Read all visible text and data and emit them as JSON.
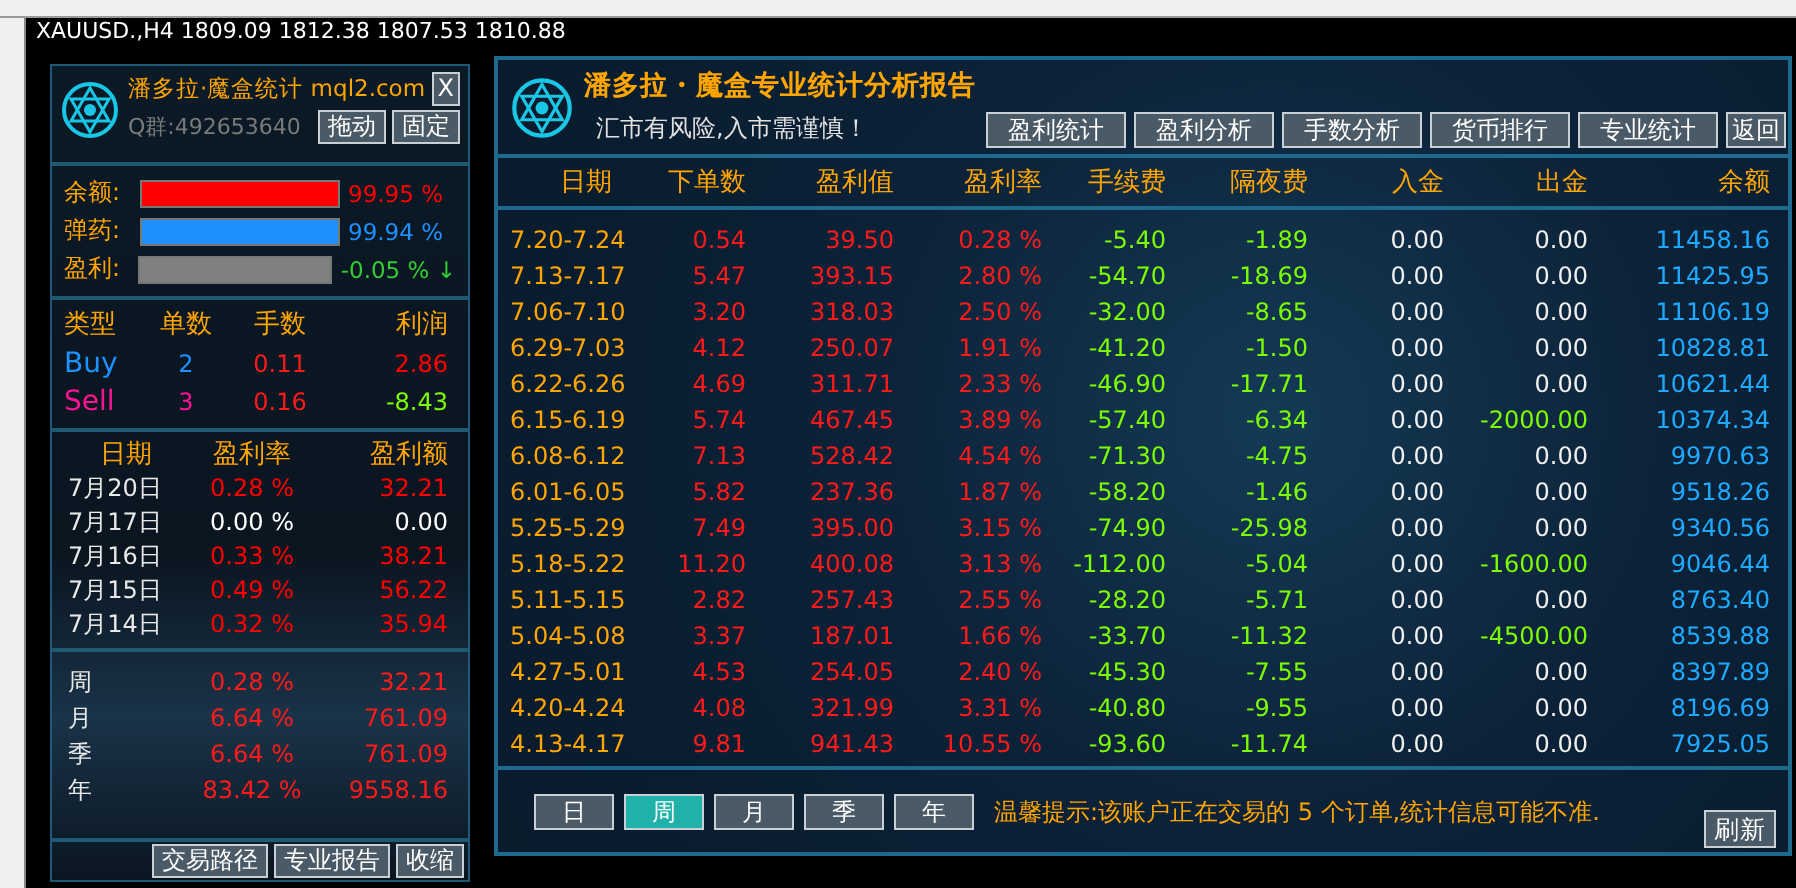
{
  "chart_header": "XAUUSD.,H4  1809.09 1812.38 1807.53 1810.88",
  "mini_panel": {
    "title": "潘多拉·魔盒统计 mql2.com",
    "close": "X",
    "qq": "Q群:492653640",
    "buttons": [
      "拖动",
      "固定"
    ],
    "gauges": [
      {
        "label": "余额:",
        "level": 0.9995,
        "reading": "99.95 %",
        "color": "#ff0000"
      },
      {
        "label": "弹药:",
        "level": 0.9994,
        "reading": "99.94 %",
        "color": "#1e90ff"
      },
      {
        "label": "盈利:",
        "level": 1,
        "reading": "-0.05 % ↓",
        "color": "#808080"
      }
    ],
    "trade_columns": [
      "类型",
      "单数",
      "手数",
      "利润"
    ],
    "trades": [
      {
        "type": "Buy",
        "color": "#1e90ff",
        "orders": "2",
        "lots": "0.11",
        "profit": {
          "text": "2.86",
          "color": "#ff0000"
        }
      },
      {
        "type": "Sell",
        "color": "#ff1493",
        "orders": "3",
        "lots": "0.16",
        "profit": {
          "text": "-8.43",
          "color": "#7cfc00"
        }
      }
    ],
    "day_columns": [
      "日期",
      "盈利率",
      "盈利额"
    ],
    "days": [
      {
        "date": "7月20日",
        "rate": "0.28 %",
        "amount": "32.21",
        "color": "#ff0000"
      },
      {
        "date": "7月17日",
        "rate": "0.00 %",
        "amount": "0.00",
        "color": "#ffffff"
      },
      {
        "date": "7月16日",
        "rate": "0.33 %",
        "amount": "38.21",
        "color": "#ff0000"
      },
      {
        "date": "7月15日",
        "rate": "0.49 %",
        "amount": "56.22",
        "color": "#ff0000"
      },
      {
        "date": "7月14日",
        "rate": "0.32 %",
        "amount": "35.94",
        "color": "#ff0000"
      }
    ],
    "periods": [
      {
        "label": "周",
        "rate": "0.28 %",
        "amount": "32.21"
      },
      {
        "label": "月",
        "rate": "6.64 %",
        "amount": "761.09"
      },
      {
        "label": "季",
        "rate": "6.64 %",
        "amount": "761.09"
      },
      {
        "label": "年",
        "rate": "83.42 %",
        "amount": "9558.16"
      }
    ],
    "footer_buttons": [
      "交易路径",
      "专业报告",
      "收缩"
    ]
  },
  "report": {
    "title": "潘多拉・魔盒专业统计分析报告",
    "subtitle": "汇市有风险,入市需谨慎！",
    "nav_buttons": [
      "盈利统计",
      "盈利分析",
      "手数分析",
      "货币排行",
      "专业统计"
    ],
    "back": "返回",
    "columns": [
      "日期",
      "下单数",
      "盈利值",
      "盈利率",
      "手续费",
      "隔夜费",
      "入金",
      "出金",
      "余额"
    ],
    "rows": [
      {
        "cells": [
          "7.20-7.24",
          "0.54",
          "39.50",
          "0.28 %",
          "-5.40",
          "-1.89",
          "0.00",
          "0.00",
          "11458.16"
        ],
        "withdrawal": false
      },
      {
        "cells": [
          "7.13-7.17",
          "5.47",
          "393.15",
          "2.80 %",
          "-54.70",
          "-18.69",
          "0.00",
          "0.00",
          "11425.95"
        ],
        "withdrawal": false
      },
      {
        "cells": [
          "7.06-7.10",
          "3.20",
          "318.03",
          "2.50 %",
          "-32.00",
          "-8.65",
          "0.00",
          "0.00",
          "11106.19"
        ],
        "withdrawal": false
      },
      {
        "cells": [
          "6.29-7.03",
          "4.12",
          "250.07",
          "1.91 %",
          "-41.20",
          "-1.50",
          "0.00",
          "0.00",
          "10828.81"
        ],
        "withdrawal": false
      },
      {
        "cells": [
          "6.22-6.26",
          "4.69",
          "311.71",
          "2.33 %",
          "-46.90",
          "-17.71",
          "0.00",
          "0.00",
          "10621.44"
        ],
        "withdrawal": false
      },
      {
        "cells": [
          "6.15-6.19",
          "5.74",
          "467.45",
          "3.89 %",
          "-57.40",
          "-6.34",
          "0.00",
          "-2000.00",
          "10374.34"
        ],
        "withdrawal": true
      },
      {
        "cells": [
          "6.08-6.12",
          "7.13",
          "528.42",
          "4.54 %",
          "-71.30",
          "-4.75",
          "0.00",
          "0.00",
          "9970.63"
        ],
        "withdrawal": false
      },
      {
        "cells": [
          "6.01-6.05",
          "5.82",
          "237.36",
          "1.87 %",
          "-58.20",
          "-1.46",
          "0.00",
          "0.00",
          "9518.26"
        ],
        "withdrawal": false
      },
      {
        "cells": [
          "5.25-5.29",
          "7.49",
          "395.00",
          "3.15 %",
          "-74.90",
          "-25.98",
          "0.00",
          "0.00",
          "9340.56"
        ],
        "withdrawal": false
      },
      {
        "cells": [
          "5.18-5.22",
          "11.20",
          "400.08",
          "3.13 %",
          "-112.00",
          "-5.04",
          "0.00",
          "-1600.00",
          "9046.44"
        ],
        "withdrawal": true
      },
      {
        "cells": [
          "5.11-5.15",
          "2.82",
          "257.43",
          "2.55 %",
          "-28.20",
          "-5.71",
          "0.00",
          "0.00",
          "8763.40"
        ],
        "withdrawal": false
      },
      {
        "cells": [
          "5.04-5.08",
          "3.37",
          "187.01",
          "1.66 %",
          "-33.70",
          "-11.32",
          "0.00",
          "-4500.00",
          "8539.88"
        ],
        "withdrawal": true
      },
      {
        "cells": [
          "4.27-5.01",
          "4.53",
          "254.05",
          "2.40 %",
          "-45.30",
          "-7.55",
          "0.00",
          "0.00",
          "8397.89"
        ],
        "withdrawal": false
      },
      {
        "cells": [
          "4.20-4.24",
          "4.08",
          "321.99",
          "3.31 %",
          "-40.80",
          "-9.55",
          "0.00",
          "0.00",
          "8196.69"
        ],
        "withdrawal": false
      },
      {
        "cells": [
          "4.13-4.17",
          "9.81",
          "941.43",
          "10.55 %",
          "-93.60",
          "-11.74",
          "0.00",
          "0.00",
          "7925.05"
        ],
        "withdrawal": false
      }
    ],
    "period_tabs": [
      {
        "label": "日",
        "selected": false
      },
      {
        "label": "周",
        "selected": true
      },
      {
        "label": "月",
        "selected": false
      },
      {
        "label": "季",
        "selected": false
      },
      {
        "label": "年",
        "selected": false
      }
    ],
    "notice": "温馨提示:该账户正在交易的 5 个订单,统计信息可能不准.",
    "refresh": "刷新"
  }
}
